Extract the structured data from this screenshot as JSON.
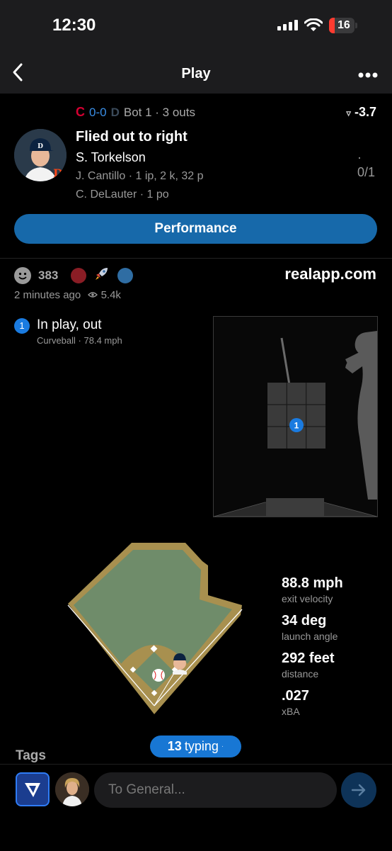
{
  "status_bar": {
    "time": "12:30",
    "battery": "16"
  },
  "nav": {
    "title": "Play",
    "back_icon": "chevron-left-icon",
    "more_icon": "ellipsis-icon"
  },
  "game": {
    "away_logo": "C",
    "score": "0-0",
    "home_logo": "D",
    "situation": "Bot 1 · 3 outs",
    "win_prob": "-3.7"
  },
  "play": {
    "title": "Flied out to right",
    "batter": "S. Torkelson",
    "batter_stat": "· 0/1",
    "pitcher_line": "J. Cantillo · 1 ip, 2 k, 32 p",
    "fielder_line": "C. DeLauter · 1 po"
  },
  "performance_button": "Performance",
  "reactions": {
    "count": "383",
    "site": "realapp.com",
    "time_ago": "2 minutes ago",
    "views": "5.4k"
  },
  "pitch": {
    "number": "1",
    "result": "In play, out",
    "type": "Curveball",
    "speed": "78.4 mph"
  },
  "stats": [
    {
      "value": "88.8 mph",
      "label": "exit velocity"
    },
    {
      "value": "34 deg",
      "label": "launch angle"
    },
    {
      "value": "292 feet",
      "label": "distance"
    },
    {
      "value": ".027",
      "label": "xBA"
    }
  ],
  "typing": {
    "count": "13",
    "label": "typing"
  },
  "tags_label": "Tags",
  "composer": {
    "placeholder": "To General..."
  },
  "colors": {
    "accent": "#1769aa",
    "field_grass": "#6f8c6a",
    "field_dirt": "#a8904f",
    "guardians_red": "#d50032"
  }
}
